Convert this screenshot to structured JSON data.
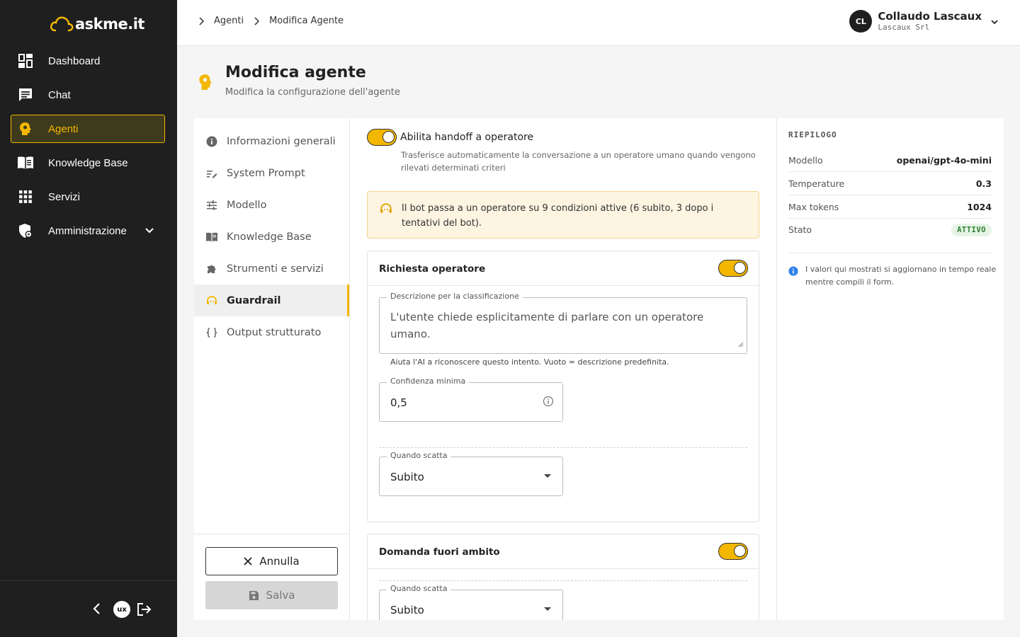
{
  "brand": {
    "name": "askme.it",
    "accent": "#f3b700"
  },
  "sidebar": {
    "items": [
      {
        "label": "Dashboard",
        "icon": "dashboard-icon"
      },
      {
        "label": "Chat",
        "icon": "chat-icon"
      },
      {
        "label": "Agenti",
        "icon": "agent-icon",
        "active": true
      },
      {
        "label": "Knowledge Base",
        "icon": "book-icon"
      },
      {
        "label": "Servizi",
        "icon": "grid-icon"
      },
      {
        "label": "Amministrazione",
        "icon": "admin-shield-icon",
        "expandable": true
      }
    ],
    "footer_logo": "ux"
  },
  "breadcrumb": [
    "Agenti",
    "Modifica Agente"
  ],
  "user": {
    "initials": "CL",
    "name": "Collaudo Lascaux",
    "org": "Lascaux Srl"
  },
  "page": {
    "title": "Modifica agente",
    "subtitle": "Modifica la configurazione dell'agente"
  },
  "sections": [
    {
      "label": "Informazioni generali",
      "icon": "info-icon"
    },
    {
      "label": "System Prompt",
      "icon": "prompt-icon"
    },
    {
      "label": "Modello",
      "icon": "sliders-icon"
    },
    {
      "label": "Knowledge Base",
      "icon": "book-icon"
    },
    {
      "label": "Strumenti e servizi",
      "icon": "puzzle-icon"
    },
    {
      "label": "Guardrail",
      "icon": "support-agent-icon",
      "active": true
    },
    {
      "label": "Output strutturato",
      "icon": "braces-icon"
    }
  ],
  "actions": {
    "cancel_label": "Annulla",
    "save_label": "Salva"
  },
  "handoff": {
    "label": "Abilita handoff a operatore",
    "description": "Trasferisce automaticamente la conversazione a un operatore umano quando vengono rilevati determinati criteri",
    "enabled": true
  },
  "alert": {
    "text": "Il bot passa a un operatore su 9 condizioni attive (6 subito, 3 dopo i tentativi del bot)."
  },
  "rules": [
    {
      "title": "Richiesta operatore",
      "enabled": true,
      "description_label": "Descrizione per la classificazione",
      "description_value": "L'utente chiede esplicitamente di parlare con un operatore umano.",
      "description_helper": "Aiuta l'AI a riconoscere questo intento. Vuoto = descrizione predefinita.",
      "confidence_label": "Confidenza minima",
      "confidence_value": "0,5",
      "trigger_label": "Quando scatta",
      "trigger_value": "Subito"
    },
    {
      "title": "Domanda fuori ambito",
      "enabled": true,
      "trigger_label": "Quando scatta",
      "trigger_value": "Subito"
    }
  ],
  "summary": {
    "heading": "RIEPILOGO",
    "rows": [
      {
        "key": "Modello",
        "value": "openai/gpt-4o-mini"
      },
      {
        "key": "Temperature",
        "value": "0.3"
      },
      {
        "key": "Max tokens",
        "value": "1024"
      },
      {
        "key": "Stato",
        "value": "ATTIVO"
      }
    ],
    "note": "I valori qui mostrati si aggiornano in tempo reale mentre compili il form."
  }
}
